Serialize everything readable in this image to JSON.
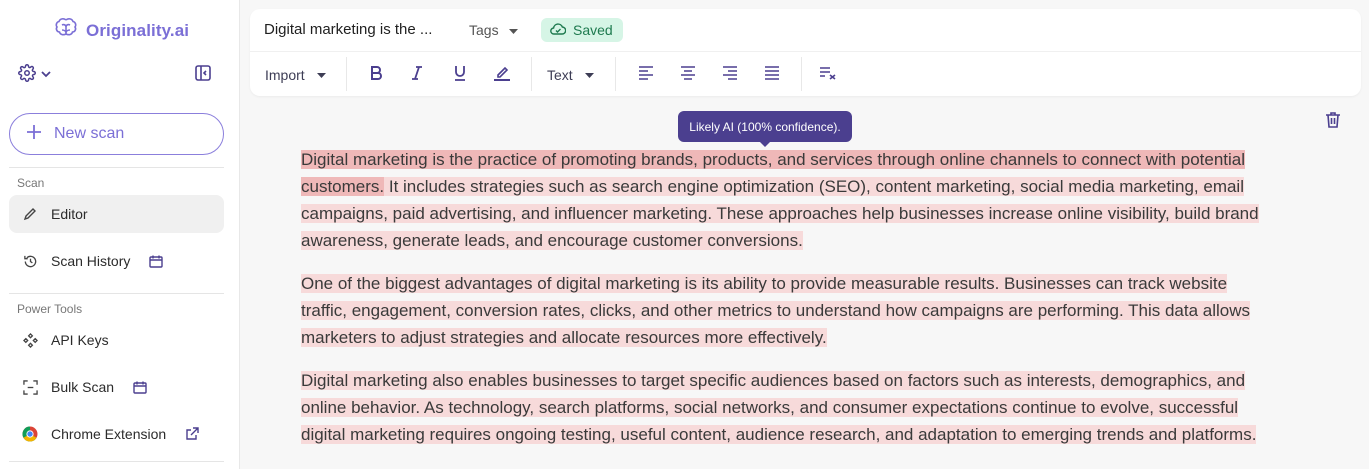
{
  "app": {
    "logo_text": "Originality.ai"
  },
  "sidebar": {
    "new_scan_label": "New scan",
    "scan_section_label": "Scan",
    "power_tools_label": "Power Tools",
    "items": [
      {
        "label": "Editor",
        "icon": "pencil-icon",
        "active": true
      },
      {
        "label": "Scan History",
        "icon": "history-icon"
      },
      {
        "label": "API Keys",
        "icon": "api-keys-icon"
      },
      {
        "label": "Bulk Scan",
        "icon": "bulk-scan-icon"
      },
      {
        "label": "Chrome Extension",
        "icon": "chrome-icon"
      }
    ]
  },
  "header": {
    "doc_title": "Digital marketing is the ...",
    "tags_label": "Tags",
    "saved_label": "Saved"
  },
  "toolbar": {
    "import_label": "Import",
    "text_style_label": "Text"
  },
  "tooltip": {
    "text": "Likely AI (100% confidence)."
  },
  "content": {
    "p1_highlight": "Digital marketing is the practice of promoting brands, products, and services through online channels to connect with potential customers.",
    "p1_rest": " It includes strategies such as search engine optimization (SEO), content marketing, social media marketing, email campaigns, paid advertising, and influencer marketing. These approaches help businesses increase online visibility, build brand awareness, generate leads, and encourage customer conversions.",
    "p2": "One of the biggest advantages of digital marketing is its ability to provide measurable results. Businesses can track website traffic, engagement, conversion rates, clicks, and other metrics to understand how campaigns are performing. This data allows marketers to adjust strategies and allocate resources more effectively.",
    "p3": "Digital marketing also enables businesses to target specific audiences based on factors such as interests, demographics, and online behavior. As technology, search platforms, social networks, and consumer expectations continue to evolve, successful digital marketing requires ongoing testing, useful content, audience research, and adaptation to emerging trends and platforms."
  },
  "colors": {
    "accent": "#7b6fd6",
    "highlight_strong": "#efb8b8",
    "highlight": "#f7dada",
    "saved_bg": "#d6f5e6",
    "tooltip_bg": "#4b3f8f"
  }
}
